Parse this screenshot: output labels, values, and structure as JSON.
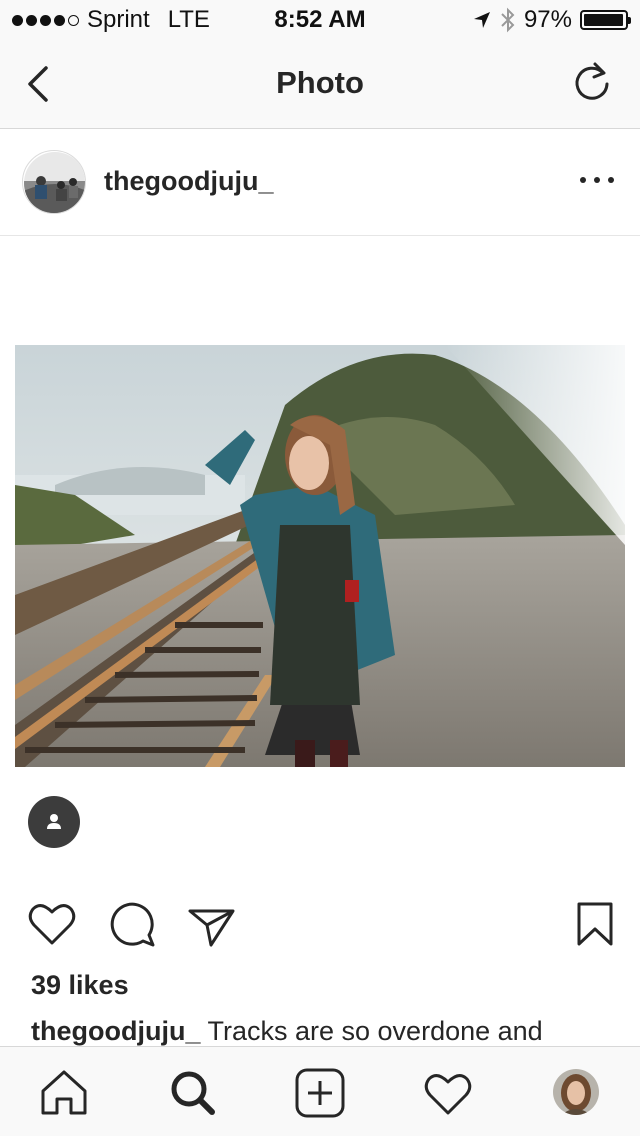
{
  "status_bar": {
    "carrier": "Sprint",
    "network": "LTE",
    "time": "8:52 AM",
    "battery_percent": "97%",
    "battery_level": 0.97,
    "signal_bars_filled": 4,
    "signal_bars_total": 5,
    "icons": [
      "location-arrow-icon",
      "bluetooth-icon",
      "battery-icon"
    ]
  },
  "nav": {
    "title": "Photo",
    "back_icon": "chevron-left-icon",
    "refresh_icon": "refresh-icon"
  },
  "post": {
    "username": "thegoodjuju_",
    "more_icon": "more-horizontal-icon",
    "tag_icon": "person-icon",
    "likes": "39 likes",
    "caption_user": "thegoodjuju_",
    "caption_text": " Tracks are so overdone and"
  },
  "actions": {
    "icons": [
      "heart-icon",
      "comment-icon",
      "share-icon",
      "bookmark-icon"
    ]
  },
  "tab_bar": {
    "icons": [
      "home-icon",
      "search-icon",
      "add-icon",
      "activity-heart-icon",
      "profile-avatar"
    ]
  },
  "colors": {
    "text": "#262626",
    "bar_background": "#f9f9f9",
    "divider": "#d8d8d8",
    "tag_bubble": "#3c3c3c"
  }
}
